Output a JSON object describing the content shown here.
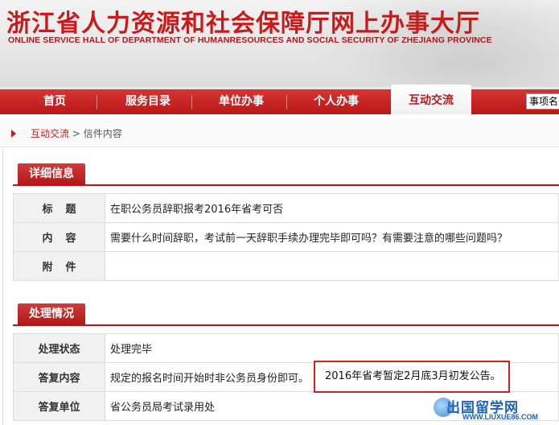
{
  "header": {
    "title": "浙江省人力资源和社会保障厅网上办事大厅",
    "subtitle": "ONLINE SERVICE HALL OF DEPARTMENT OF HUMANRESOURCES AND SOCIAL SECURITY OF ZHEJIANG PROVINCE"
  },
  "nav": {
    "items": [
      {
        "label": "首页"
      },
      {
        "label": "服务目录"
      },
      {
        "label": "单位办事"
      },
      {
        "label": "个人办事"
      },
      {
        "label": "互动交流",
        "active": true
      }
    ],
    "select_value": "事项名"
  },
  "breadcrumb": {
    "link": "互动交流",
    "separator": ">",
    "current": "信件内容"
  },
  "detail": {
    "heading": "详细信息",
    "rows": [
      {
        "label": "标题",
        "value": "在职公务员辞职报考2016年省考可否"
      },
      {
        "label": "内容",
        "value": "需要什么时间辞职，考试前一天辞职手续办理完毕即可吗？有需要注意的哪些问题吗？"
      },
      {
        "label": "附件",
        "value": ""
      }
    ]
  },
  "processing": {
    "heading": "处理情况",
    "rows": [
      {
        "label": "处理状态",
        "value": "处理完毕"
      },
      {
        "label": "答复内容",
        "value": "规定的报名时间开始时非公务员身份即可。"
      },
      {
        "label": "答复单位",
        "value": "省公务员局考试录用处"
      }
    ],
    "highlight": "2016年省考暂定2月底3月初发公告。"
  },
  "watermark": {
    "logo": "出国留学网",
    "url": "WWW.LIUXUE86.COM"
  },
  "colors": {
    "brand_red": "#c81c1c",
    "nav_red": "#b81818",
    "watermark_blue": "#1e63b8"
  }
}
